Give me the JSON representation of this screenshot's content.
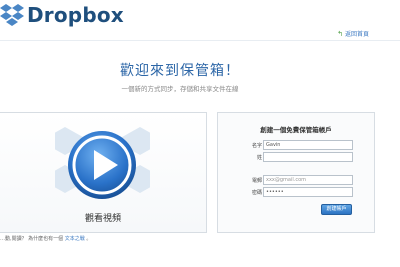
{
  "header": {
    "logo_text": "Dropbox",
    "back_link": "返回首頁"
  },
  "hero": {
    "title": "歡迎來到保管箱！",
    "subtitle": "一個新的方式同步，存儲和共享文件在線"
  },
  "video": {
    "caption": "觀看視頻"
  },
  "signup": {
    "title": "創建一個免費保管箱帳戶",
    "fields": [
      {
        "label": "名字",
        "value": "Gavin"
      },
      {
        "label": "姓",
        "value": ""
      },
      {
        "label": "電郵",
        "value": "xxx@gmail.com"
      },
      {
        "label": "密碼",
        "value": "••••••"
      }
    ],
    "button_label": "創建帳戶"
  },
  "footer": {
    "prefix": "…動,閱讀？ 為什麼也有一個",
    "link": "文本之戰",
    "suffix": "。"
  },
  "colors": {
    "brand": "#1f4f7d",
    "accent": "#2c66a7",
    "link": "#3d7ac2"
  }
}
